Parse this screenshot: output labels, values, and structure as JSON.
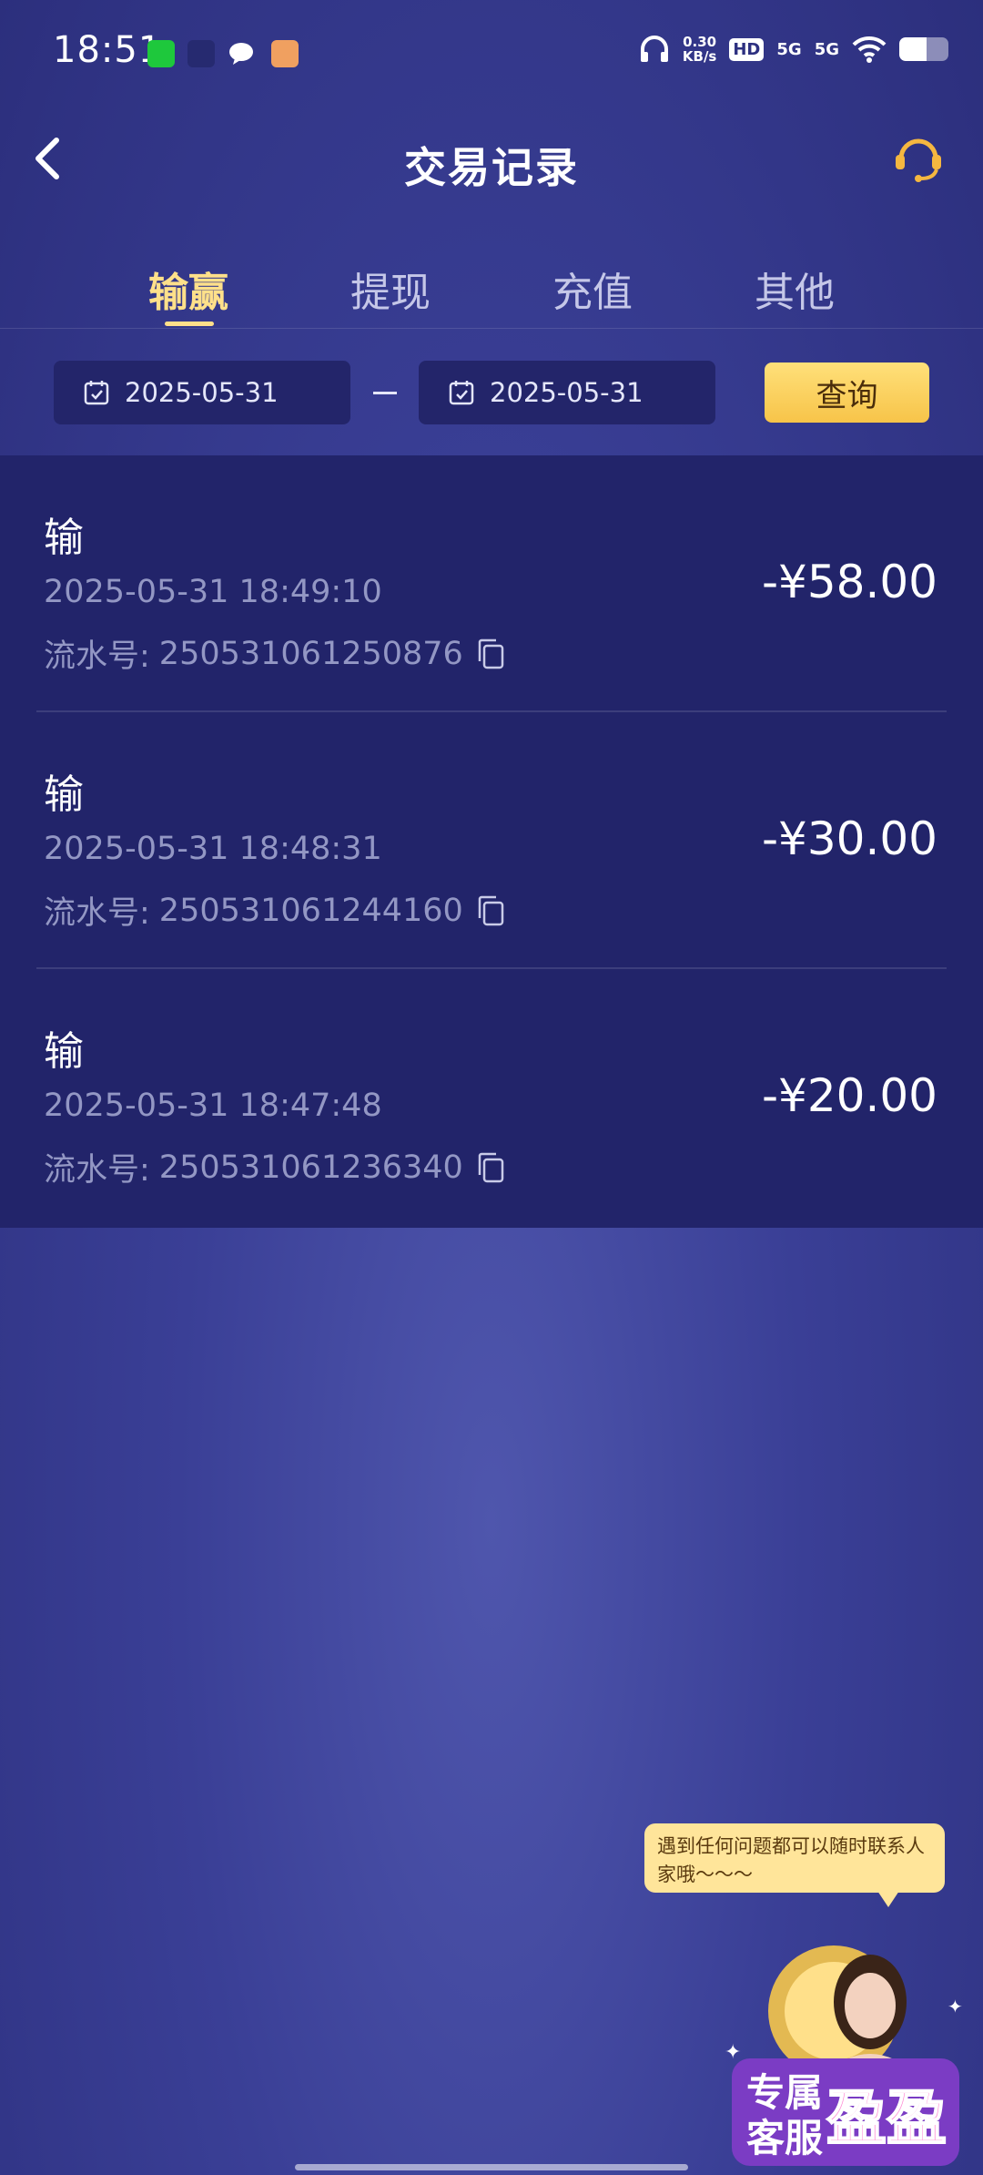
{
  "status_bar": {
    "time": "18:51",
    "net_speed_value": "0.30",
    "net_speed_unit": "KB/s",
    "hd_label": "HD",
    "signal1": "5G",
    "signal2": "5G",
    "battery_level": 0.55
  },
  "header": {
    "title": "交易记录"
  },
  "tabs": [
    {
      "label": "输赢",
      "active": true
    },
    {
      "label": "提现",
      "active": false
    },
    {
      "label": "充值",
      "active": false
    },
    {
      "label": "其他",
      "active": false
    }
  ],
  "filter": {
    "start_date": "2025-05-31",
    "end_date": "2025-05-31",
    "query_label": "查询"
  },
  "records": [
    {
      "type": "输",
      "time": "2025-05-31 18:49:10",
      "serial_label": "流水号:",
      "serial": "250531061250876",
      "amount": "-¥58.00"
    },
    {
      "type": "输",
      "time": "2025-05-31 18:48:31",
      "serial_label": "流水号:",
      "serial": "250531061244160",
      "amount": "-¥30.00"
    },
    {
      "type": "输",
      "time": "2025-05-31 18:47:48",
      "serial_label": "流水号:",
      "serial": "250531061236340",
      "amount": "-¥20.00"
    }
  ],
  "service_float": {
    "tooltip": "遇到任何问题都可以随时联系人家哦～～～",
    "badge_line1": "专属",
    "badge_line2": "客服",
    "badge_name": "盈盈"
  },
  "colors": {
    "accent": "#ffe08a",
    "list_bg": "#22246a",
    "button": "#f7c449"
  }
}
